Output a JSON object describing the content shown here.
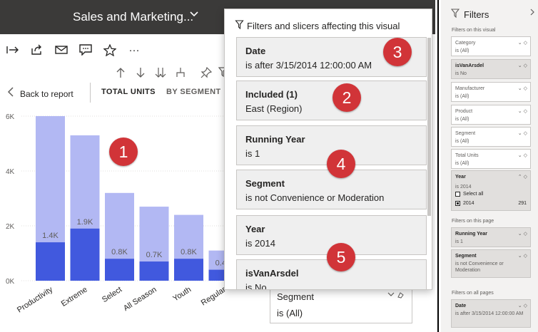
{
  "header": {
    "title": "Sales and Marketing...",
    "title_chevron": "chevron-down-icon"
  },
  "toolbar": {
    "icons": [
      "enter-focus-icon",
      "share-icon",
      "email-icon",
      "comment-icon",
      "favorite-star-icon",
      "more-options-icon"
    ],
    "more": "···"
  },
  "visual_header": {
    "icons": [
      "drill-up-icon",
      "drill-down-icon",
      "expand-all-icon",
      "hierarchy-icon",
      "pin-icon",
      "filter-icon"
    ]
  },
  "report": {
    "back_label": "Back to report",
    "tabs": [
      {
        "label": "TOTAL UNITS",
        "active": true
      },
      {
        "label": "BY SEGMENT",
        "active": false
      }
    ]
  },
  "chart_data": {
    "type": "bar",
    "categories": [
      "Productivity",
      "Extreme",
      "Select",
      "All Season",
      "Youth",
      "Regular"
    ],
    "series": [
      {
        "values": [
          6.0,
          5.3,
          3.2,
          2.7,
          2.4,
          1.1
        ],
        "color": "#b2b8f3"
      },
      {
        "values": [
          1.4,
          1.9,
          0.8,
          0.7,
          0.8,
          0.4
        ],
        "color": "#4159de",
        "labels": [
          "1.4K",
          "1.9K",
          "0.8K",
          "0.7K",
          "0.8K",
          "0.4K"
        ]
      }
    ],
    "ylim": [
      0,
      6
    ],
    "yticks": [
      "0K",
      "2K",
      "4K",
      "6K"
    ],
    "grid": true
  },
  "left_slicer": {
    "title": "Segment",
    "value": "is (All)"
  },
  "popup": {
    "title": "Filters and slicers affecting this visual",
    "cards": [
      {
        "title": "Date",
        "value": "is after 3/15/2014 12:00:00 AM"
      },
      {
        "title": "Included (1)",
        "value": "East (Region)"
      },
      {
        "title": "Running Year",
        "value": "is 1"
      },
      {
        "title": "Segment",
        "value": "is not Convenience or Moderation"
      },
      {
        "title": "Year",
        "value": "is 2014"
      },
      {
        "title": "isVanArsdel",
        "value": "is No"
      }
    ]
  },
  "badges": [
    "1",
    "2",
    "3",
    "4",
    "5"
  ],
  "badge_color": "#d13438",
  "filters_pane": {
    "title": "Filters",
    "visual_section": "Filters on this visual",
    "visual_filters": [
      {
        "title": "Category",
        "value": "is (All)"
      },
      {
        "title": "isVanArsdel",
        "value": "is No"
      },
      {
        "title": "Manufacturer",
        "value": "is (All)"
      },
      {
        "title": "Product",
        "value": "is (All)"
      },
      {
        "title": "Segment",
        "value": "is (All)"
      },
      {
        "title": "Total Units",
        "value": "is (All)"
      }
    ],
    "year_filter": {
      "title": "Year",
      "value": "is 2014",
      "select_all": "Select all",
      "option": "2014",
      "count": "291"
    },
    "page_section": "Filters on this page",
    "page_filters": [
      {
        "title": "Running Year",
        "value": "is 1"
      },
      {
        "title": "Segment",
        "value": "is not Convenience or Moderation"
      }
    ],
    "all_section": "Filters on all pages",
    "all_filters": [
      {
        "title": "Date",
        "value": "is after 3/15/2014 12:00:00 AM"
      }
    ]
  }
}
